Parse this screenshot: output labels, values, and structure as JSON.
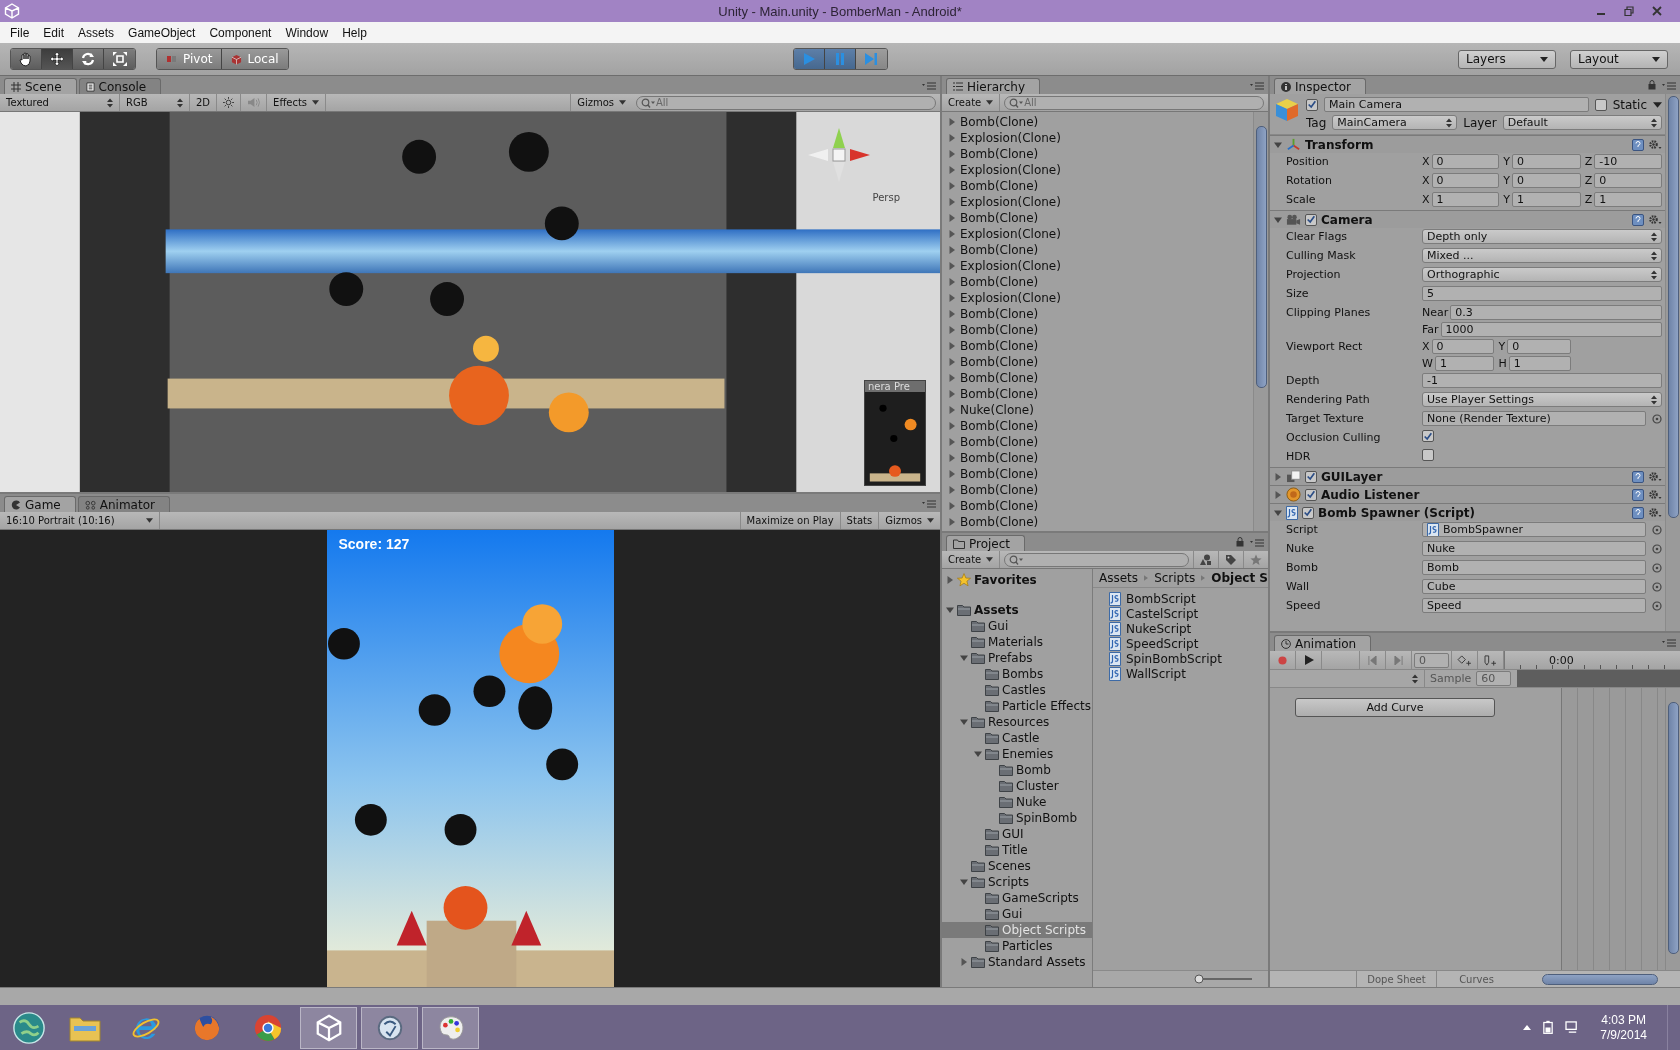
{
  "window": {
    "title": "Unity - Main.unity - BomberMan - Android*"
  },
  "menu": [
    "File",
    "Edit",
    "Assets",
    "GameObject",
    "Component",
    "Window",
    "Help"
  ],
  "toolbar": {
    "tools": [
      {
        "kind": "hand",
        "selected": false
      },
      {
        "kind": "move",
        "selected": true
      },
      {
        "kind": "rotate",
        "selected": false
      },
      {
        "kind": "scale",
        "selected": false
      }
    ],
    "pivot": "Pivot",
    "space": "Local",
    "playback": [
      {
        "kind": "play",
        "on": true
      },
      {
        "kind": "pause",
        "on": true
      },
      {
        "kind": "step",
        "on": false
      }
    ],
    "layers": "Layers",
    "layout": "Layout"
  },
  "scene_panel": {
    "tabs": [
      {
        "label": "Scene",
        "selected": true
      },
      {
        "label": "Console",
        "selected": false
      }
    ],
    "render_mode": "Textured",
    "channel": "RGB",
    "mode_2d": "2D",
    "audio_on": false,
    "effects": "Effects",
    "gizmos": "Gizmos",
    "search_placeholder": "All",
    "gizmo_label": "Persp",
    "preview_title": "nera Pre"
  },
  "game_panel": {
    "tabs": [
      {
        "label": "Game",
        "selected": true
      },
      {
        "label": "Animator",
        "selected": false
      }
    ],
    "aspect": "16:10 Portrait (10:16)",
    "buttons": [
      "Maximize on Play",
      "Stats"
    ],
    "gizmos": "Gizmos",
    "score": "Score: 127"
  },
  "hierarchy": {
    "title": "Hierarchy",
    "create": "Create",
    "search_placeholder": "All",
    "items": [
      {
        "label": "Bomb(Clone)",
        "expanded": false
      },
      {
        "label": "Explosion(Clone)",
        "expanded": false
      },
      {
        "label": "Bomb(Clone)",
        "expanded": false
      },
      {
        "label": "Explosion(Clone)",
        "expanded": false
      },
      {
        "label": "Bomb(Clone)",
        "expanded": false
      },
      {
        "label": "Explosion(Clone)",
        "expanded": false
      },
      {
        "label": "Bomb(Clone)",
        "expanded": false
      },
      {
        "label": "Explosion(Clone)",
        "expanded": false
      },
      {
        "label": "Bomb(Clone)",
        "expanded": false
      },
      {
        "label": "Explosion(Clone)",
        "expanded": false
      },
      {
        "label": "Bomb(Clone)",
        "expanded": false
      },
      {
        "label": "Explosion(Clone)",
        "expanded": false
      },
      {
        "label": "Bomb(Clone)",
        "expanded": false
      },
      {
        "label": "Bomb(Clone)",
        "expanded": false
      },
      {
        "label": "Bomb(Clone)",
        "expanded": false
      },
      {
        "label": "Bomb(Clone)",
        "expanded": false
      },
      {
        "label": "Bomb(Clone)",
        "expanded": false
      },
      {
        "label": "Bomb(Clone)",
        "expanded": false
      },
      {
        "label": "Nuke(Clone)",
        "expanded": false
      },
      {
        "label": "Bomb(Clone)",
        "expanded": false
      },
      {
        "label": "Bomb(Clone)",
        "expanded": false
      },
      {
        "label": "Bomb(Clone)",
        "expanded": false
      },
      {
        "label": "Bomb(Clone)",
        "expanded": false
      },
      {
        "label": "Bomb(Clone)",
        "expanded": false
      },
      {
        "label": "Bomb(Clone)",
        "expanded": false
      },
      {
        "label": "Bomb(Clone)",
        "expanded": false
      }
    ]
  },
  "project": {
    "title": "Project",
    "create": "Create",
    "favorites": {
      "label": "Favorites",
      "expanded": false
    },
    "tree": [
      {
        "label": "Assets",
        "expanded": true,
        "selected": false,
        "children": [
          {
            "label": "Gui",
            "selected": false
          },
          {
            "label": "Materials",
            "selected": false
          },
          {
            "label": "Prefabs",
            "expanded": true,
            "selected": false,
            "children": [
              {
                "label": "Bombs",
                "selected": false
              },
              {
                "label": "Castles",
                "selected": false
              },
              {
                "label": "Particle Effects",
                "selected": false
              }
            ]
          },
          {
            "label": "Resources",
            "expanded": true,
            "selected": false,
            "children": [
              {
                "label": "Castle",
                "selected": false
              },
              {
                "label": "Enemies",
                "expanded": true,
                "selected": false,
                "children": [
                  {
                    "label": "Bomb",
                    "selected": false
                  },
                  {
                    "label": "Cluster",
                    "selected": false
                  },
                  {
                    "label": "Nuke",
                    "selected": false
                  },
                  {
                    "label": "SpinBomb",
                    "selected": false
                  }
                ]
              },
              {
                "label": "GUI",
                "selected": false
              },
              {
                "label": "Title",
                "selected": false
              }
            ]
          },
          {
            "label": "Scenes",
            "selected": false
          },
          {
            "label": "Scripts",
            "expanded": true,
            "selected": false,
            "children": [
              {
                "label": "GameScripts",
                "selected": false
              },
              {
                "label": "Gui",
                "selected": false
              },
              {
                "label": "Object Scripts",
                "selected": true
              },
              {
                "label": "Particles",
                "selected": false
              }
            ]
          },
          {
            "label": "Standard Assets",
            "expanded": false,
            "selected": false
          }
        ]
      }
    ],
    "breadcrumb": [
      "Assets",
      "Scripts",
      "Object S"
    ],
    "files": [
      "BombScript",
      "CastelScript",
      "NukeScript",
      "SpeedScript",
      "SpinBombScript",
      "WallScript"
    ],
    "zoom": {
      "level": 0
    }
  },
  "inspector": {
    "title": "Inspector",
    "object": {
      "active": true,
      "name": "Main Camera",
      "static": false,
      "static_label": "Static",
      "tag_label": "Tag",
      "tag": "MainCamera",
      "layer_label": "Layer",
      "layer": "Default"
    },
    "components": [
      {
        "name": "Transform",
        "kind": "transform",
        "expanded": true,
        "rows": [
          {
            "kind": "grid",
            "label": "Position",
            "lines": [
              [
                {
                  "axis": "X",
                  "value": "0"
                },
                {
                  "axis": "Y",
                  "value": "0"
                },
                {
                  "axis": "Z",
                  "value": "-10"
                }
              ]
            ]
          },
          {
            "kind": "grid",
            "label": "Rotation",
            "lines": [
              [
                {
                  "axis": "X",
                  "value": "0"
                },
                {
                  "axis": "Y",
                  "value": "0"
                },
                {
                  "axis": "Z",
                  "value": "0"
                }
              ]
            ]
          },
          {
            "kind": "grid",
            "label": "Scale",
            "lines": [
              [
                {
                  "axis": "X",
                  "value": "1"
                },
                {
                  "axis": "Y",
                  "value": "1"
                },
                {
                  "axis": "Z",
                  "value": "1"
                }
              ]
            ]
          }
        ]
      },
      {
        "name": "Camera",
        "kind": "camera",
        "enabled": true,
        "expanded": true,
        "rows": [
          {
            "kind": "dropdown",
            "label": "Clear Flags",
            "value": "Depth only"
          },
          {
            "kind": "dropdown",
            "label": "Culling Mask",
            "value": "Mixed ..."
          },
          {
            "kind": "dropdown",
            "label": "Projection",
            "value": "Orthographic"
          },
          {
            "kind": "field",
            "label": "Size",
            "value": "5"
          },
          {
            "kind": "grid",
            "label": "Clipping Planes",
            "lines": [
              [
                {
                  "axis": "Near",
                  "value": "0.3"
                }
              ],
              [
                {
                  "axis": "Far",
                  "value": "1000"
                }
              ]
            ]
          },
          {
            "kind": "grid",
            "label": "Viewport Rect",
            "lines": [
              [
                {
                  "axis": "X",
                  "value": "0"
                },
                {
                  "axis": "Y",
                  "value": "0"
                }
              ],
              [
                {
                  "axis": "W",
                  "value": "1"
                },
                {
                  "axis": "H",
                  "value": "1"
                }
              ]
            ]
          },
          {
            "kind": "field",
            "label": "Depth",
            "value": "-1"
          },
          {
            "kind": "dropdown",
            "label": "Rendering Path",
            "value": "Use Player Settings"
          },
          {
            "kind": "object",
            "label": "Target Texture",
            "value": "None (Render Texture)"
          },
          {
            "kind": "checkbox",
            "label": "Occlusion Culling",
            "checked": true
          },
          {
            "kind": "checkbox",
            "label": "HDR",
            "checked": false
          }
        ]
      },
      {
        "name": "GUILayer",
        "kind": "guilayer",
        "enabled": true,
        "expanded": false
      },
      {
        "name": "Audio Listener",
        "kind": "audio",
        "enabled": true,
        "expanded": false
      },
      {
        "name": "Bomb Spawner (Script)",
        "kind": "script",
        "enabled": true,
        "expanded": true,
        "rows": [
          {
            "kind": "script",
            "label": "Script",
            "value": "BombSpawner"
          },
          {
            "kind": "object",
            "label": "Nuke",
            "value": "Nuke"
          },
          {
            "kind": "object",
            "label": "Bomb",
            "value": "Bomb"
          },
          {
            "kind": "object",
            "label": "Wall",
            "value": "Cube"
          },
          {
            "kind": "object",
            "label": "Speed",
            "value": "Speed"
          }
        ]
      }
    ]
  },
  "animation": {
    "title": "Animation",
    "recording": false,
    "frame": "0",
    "time": "0:00",
    "sample_label": "Sample",
    "sample": "60",
    "add_curve": "Add Curve",
    "views": [
      "Dope Sheet",
      "Curves"
    ]
  },
  "taskbar": {
    "apps": [
      {
        "kind": "explorer",
        "running": false
      },
      {
        "kind": "ie",
        "running": false
      },
      {
        "kind": "firefox",
        "running": false
      },
      {
        "kind": "chrome",
        "running": false
      },
      {
        "kind": "unity",
        "running": true
      },
      {
        "kind": "app",
        "running": true
      },
      {
        "kind": "paint",
        "running": true
      }
    ],
    "time": "4:03 PM",
    "date": "7/9/2014"
  }
}
